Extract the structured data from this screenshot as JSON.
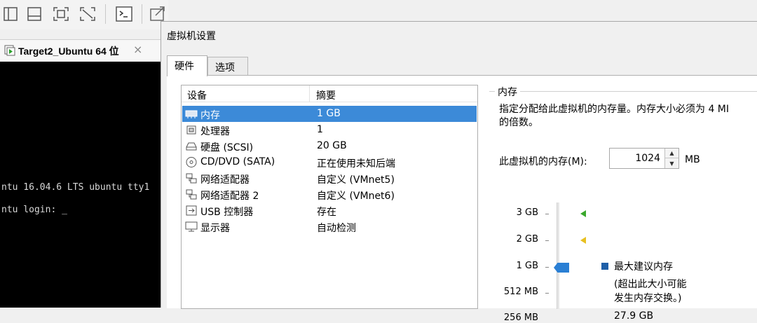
{
  "colors": {
    "selection": "#3c8ad8",
    "thumb": "#2a7fd4",
    "marker_green": "#3aa82c",
    "marker_yellow": "#e8c020",
    "legend": "#1e5fa8"
  },
  "toolbar": {
    "icons": [
      "sidebar-panel-icon",
      "bottom-panel-icon",
      "fullscreen-icon",
      "unity-icon",
      "console-icon",
      "stretch-icon"
    ]
  },
  "vm_tab": {
    "label": "Target2_Ubuntu 64 位",
    "close": "×"
  },
  "console": {
    "lines": [
      "ntu 16.04.6 LTS ubuntu tty1",
      "ntu login: _"
    ]
  },
  "dialog": {
    "title": "虚拟机设置",
    "tabs": [
      "硬件",
      "选项"
    ],
    "device_list": {
      "headers": [
        "设备",
        "摘要"
      ],
      "rows": [
        {
          "icon": "memory-icon",
          "name": "内存",
          "summary": "1 GB"
        },
        {
          "icon": "processor-icon",
          "name": "处理器",
          "summary": "1"
        },
        {
          "icon": "hard-disk-icon",
          "name": "硬盘 (SCSI)",
          "summary": "20 GB"
        },
        {
          "icon": "cd-dvd-icon",
          "name": "CD/DVD (SATA)",
          "summary": "正在使用未知后端"
        },
        {
          "icon": "network-adapter-icon",
          "name": "网络适配器",
          "summary": "自定义 (VMnet5)"
        },
        {
          "icon": "network-adapter-icon",
          "name": "网络适配器 2",
          "summary": "自定义 (VMnet6)"
        },
        {
          "icon": "usb-icon",
          "name": "USB 控制器",
          "summary": "存在"
        },
        {
          "icon": "display-icon",
          "name": "显示器",
          "summary": "自动检测"
        }
      ]
    },
    "memory": {
      "group_title": "内存",
      "description_1": "指定分配给此虚拟机的内存量。内存大小必须为 4 MI",
      "description_2": "的倍数。",
      "label": "此虚拟机的内存(M):",
      "value": "1024",
      "unit": "MB",
      "scale_labels": [
        "3 GB",
        "2 GB",
        "1 GB",
        "512 MB",
        "256 MB"
      ],
      "legend_max": "最大建议内存",
      "legend_note_1": "(超出此大小可能",
      "legend_note_2": "发生内存交换。)",
      "legend_value": "27.9 GB"
    }
  }
}
